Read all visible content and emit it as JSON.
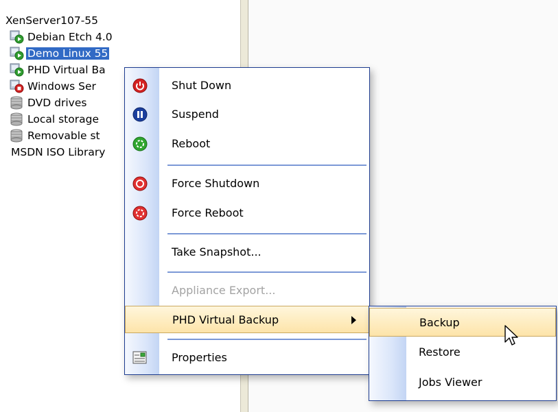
{
  "tree": {
    "items": [
      {
        "label": "XenServer107-55",
        "icon": "server-icon",
        "selected": false
      },
      {
        "label": "Debian Etch 4.0",
        "icon": "vm-running-icon",
        "selected": false
      },
      {
        "label": "Demo Linux 55",
        "icon": "vm-running-icon",
        "selected": true
      },
      {
        "label": "PHD Virtual Ba",
        "icon": "vm-running-icon",
        "selected": false
      },
      {
        "label": "Windows Ser",
        "icon": "vm-stopped-icon",
        "selected": false
      },
      {
        "label": "DVD drives",
        "icon": "storage-icon",
        "selected": false
      },
      {
        "label": "Local storage",
        "icon": "storage-icon",
        "selected": false
      },
      {
        "label": "Removable st",
        "icon": "storage-icon",
        "selected": false
      },
      {
        "label": "MSDN ISO Library",
        "icon": "",
        "selected": false
      }
    ]
  },
  "context_menu": {
    "items": [
      {
        "label": "Shut Down",
        "icon": "power-icon",
        "enabled": true
      },
      {
        "label": "Suspend",
        "icon": "pause-icon",
        "enabled": true
      },
      {
        "label": "Reboot",
        "icon": "reboot-icon",
        "enabled": true
      },
      {
        "label": "Force Shutdown",
        "icon": "force-shutdown-icon",
        "enabled": true
      },
      {
        "label": "Force Reboot",
        "icon": "force-reboot-icon",
        "enabled": true
      },
      {
        "label": "Take Snapshot...",
        "icon": "",
        "enabled": true
      },
      {
        "label": "Appliance Export...",
        "icon": "",
        "enabled": false
      },
      {
        "label": "PHD Virtual Backup",
        "icon": "",
        "enabled": true,
        "submenu": true,
        "highlighted": true
      },
      {
        "label": "Properties",
        "icon": "properties-icon",
        "enabled": true
      }
    ]
  },
  "submenu": {
    "items": [
      {
        "label": "Backup",
        "highlighted": true
      },
      {
        "label": "Restore",
        "highlighted": false
      },
      {
        "label": "Jobs Viewer",
        "highlighted": false
      }
    ]
  },
  "colors": {
    "selection": "#316ac5",
    "menu_border": "#1c3b8f",
    "hot_item": "#fde4a9",
    "disabled_text": "#a3a3a3",
    "gutter": "#c3d5f4"
  }
}
